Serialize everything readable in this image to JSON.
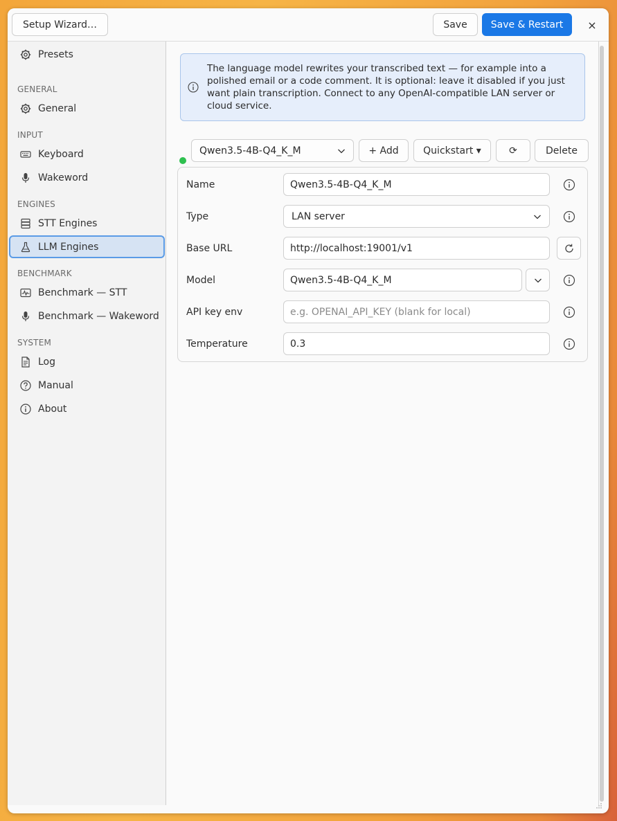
{
  "titlebar": {
    "setup_wizard": "Setup Wizard…",
    "save": "Save",
    "save_restart": "Save & Restart",
    "close": "×"
  },
  "sidebar": {
    "presets": "Presets",
    "sections": {
      "general": "GENERAL",
      "input": "INPUT",
      "engines": "ENGINES",
      "benchmark": "BENCHMARK",
      "system": "SYSTEM"
    },
    "items": {
      "general": "General",
      "keyboard": "Keyboard",
      "wakeword": "Wakeword",
      "stt_engines": "STT Engines",
      "llm_engines": "LLM Engines",
      "benchmark_stt": "Benchmark — STT",
      "benchmark_wakeword": "Benchmark — Wakeword",
      "log": "Log",
      "manual": "Manual",
      "about": "About"
    },
    "active_item": "llm_engines"
  },
  "main": {
    "info_text": "The language model rewrites your transcribed text — for example into a polished email or a code comment. It is optional: leave it disabled if you just want plain transcription. Connect to any OpenAI-compatible LAN server or cloud service.",
    "status_color": "#2ec04f",
    "engine_select": "Qwen3.5-4B-Q4_K_M",
    "add": "+ Add",
    "quickstart": "Quickstart ▾",
    "refresh": "⟳",
    "delete": "Delete",
    "form": {
      "name_label": "Name",
      "name_value": "Qwen3.5-4B-Q4_K_M",
      "type_label": "Type",
      "type_value": "LAN server",
      "base_url_label": "Base URL",
      "base_url_value": "http://localhost:19001/v1",
      "model_label": "Model",
      "model_value": "Qwen3.5-4B-Q4_K_M",
      "api_key_label": "API key env",
      "api_key_placeholder": "e.g. OPENAI_API_KEY  (blank for local)",
      "temperature_label": "Temperature",
      "temperature_value": "0.3"
    }
  },
  "colors": {
    "accent": "#1a78e6",
    "active_nav_bg": "#d6e3f3",
    "info_bg": "#e6eefb"
  }
}
